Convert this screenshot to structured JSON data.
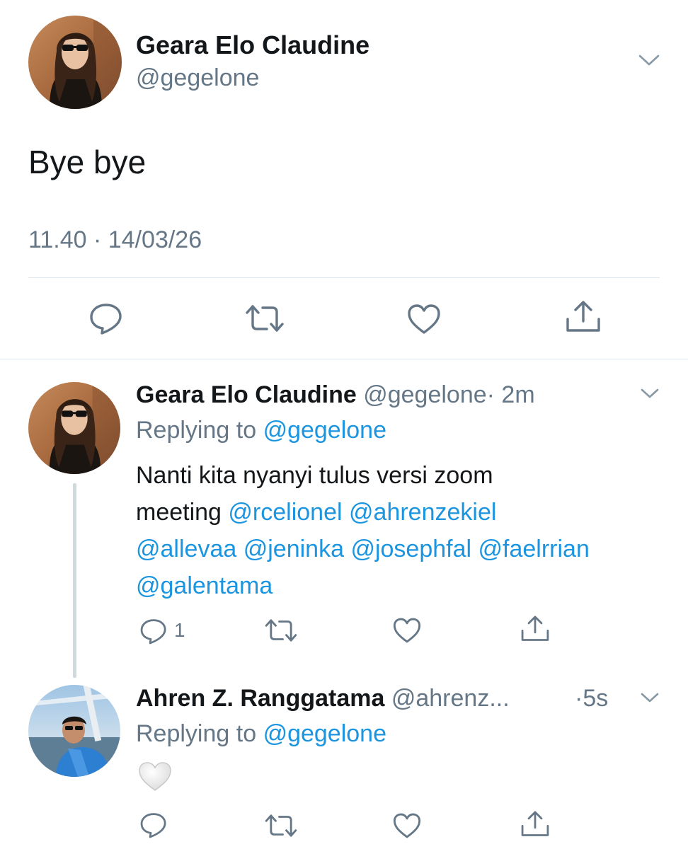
{
  "main_tweet": {
    "display_name": "Geara Elo Claudine",
    "handle": "@gegelone",
    "text": "Bye bye",
    "timestamp": "11.40 · 14/03/26"
  },
  "reply1": {
    "display_name": "Geara Elo Claudine",
    "handle": "@gegelone",
    "time": "· 2m",
    "replying_prefix": "Replying to",
    "replying_handle": "@gegelone",
    "text_lead": "Nanti kita nyanyi tulus versi zoom",
    "text_word": "meeting",
    "mentions": [
      "@rcelionel",
      "@ahrenzekiel",
      "@allevaa",
      "@jeninka",
      "@josephfal",
      "@faelrrian",
      "@galentama"
    ],
    "reply_count": "1"
  },
  "reply2": {
    "display_name": "Ahren Z. Ranggatama",
    "handle": "@ahrenz...",
    "time": "·5s",
    "replying_prefix": "Replying to",
    "replying_handle": "@gegelone",
    "emoji": "🤍"
  },
  "icons": {
    "menu": "chevron-down-icon",
    "reply": "speech-bubble-icon",
    "retweet": "retweet-icon",
    "like": "heart-icon",
    "share": "share-icon"
  },
  "colors": {
    "text": "#14171a",
    "secondary": "#657786",
    "link": "#1b95e0",
    "divider": "#e1e8ed"
  }
}
